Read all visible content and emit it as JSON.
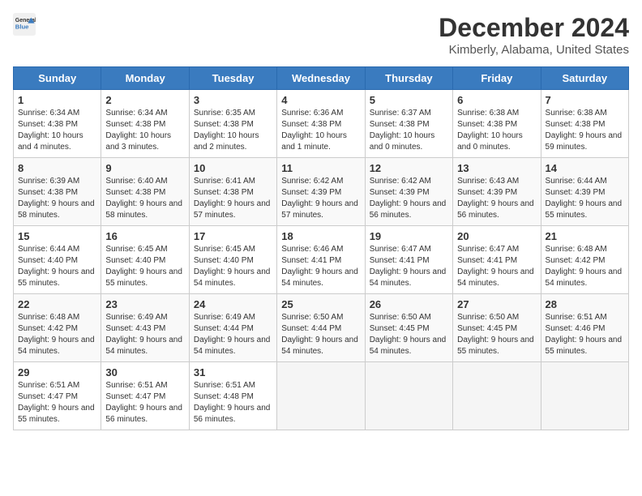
{
  "header": {
    "logo_line1": "General",
    "logo_line2": "Blue",
    "title": "December 2024",
    "subtitle": "Kimberly, Alabama, United States"
  },
  "days_of_week": [
    "Sunday",
    "Monday",
    "Tuesday",
    "Wednesday",
    "Thursday",
    "Friday",
    "Saturday"
  ],
  "weeks": [
    [
      {
        "day": "1",
        "sunrise": "6:34 AM",
        "sunset": "4:38 PM",
        "daylight": "Daylight: 10 hours and 4 minutes."
      },
      {
        "day": "2",
        "sunrise": "6:34 AM",
        "sunset": "4:38 PM",
        "daylight": "Daylight: 10 hours and 3 minutes."
      },
      {
        "day": "3",
        "sunrise": "6:35 AM",
        "sunset": "4:38 PM",
        "daylight": "Daylight: 10 hours and 2 minutes."
      },
      {
        "day": "4",
        "sunrise": "6:36 AM",
        "sunset": "4:38 PM",
        "daylight": "Daylight: 10 hours and 1 minute."
      },
      {
        "day": "5",
        "sunrise": "6:37 AM",
        "sunset": "4:38 PM",
        "daylight": "Daylight: 10 hours and 0 minutes."
      },
      {
        "day": "6",
        "sunrise": "6:38 AM",
        "sunset": "4:38 PM",
        "daylight": "Daylight: 10 hours and 0 minutes."
      },
      {
        "day": "7",
        "sunrise": "6:38 AM",
        "sunset": "4:38 PM",
        "daylight": "Daylight: 9 hours and 59 minutes."
      }
    ],
    [
      {
        "day": "8",
        "sunrise": "6:39 AM",
        "sunset": "4:38 PM",
        "daylight": "Daylight: 9 hours and 58 minutes."
      },
      {
        "day": "9",
        "sunrise": "6:40 AM",
        "sunset": "4:38 PM",
        "daylight": "Daylight: 9 hours and 58 minutes."
      },
      {
        "day": "10",
        "sunrise": "6:41 AM",
        "sunset": "4:38 PM",
        "daylight": "Daylight: 9 hours and 57 minutes."
      },
      {
        "day": "11",
        "sunrise": "6:42 AM",
        "sunset": "4:39 PM",
        "daylight": "Daylight: 9 hours and 57 minutes."
      },
      {
        "day": "12",
        "sunrise": "6:42 AM",
        "sunset": "4:39 PM",
        "daylight": "Daylight: 9 hours and 56 minutes."
      },
      {
        "day": "13",
        "sunrise": "6:43 AM",
        "sunset": "4:39 PM",
        "daylight": "Daylight: 9 hours and 56 minutes."
      },
      {
        "day": "14",
        "sunrise": "6:44 AM",
        "sunset": "4:39 PM",
        "daylight": "Daylight: 9 hours and 55 minutes."
      }
    ],
    [
      {
        "day": "15",
        "sunrise": "6:44 AM",
        "sunset": "4:40 PM",
        "daylight": "Daylight: 9 hours and 55 minutes."
      },
      {
        "day": "16",
        "sunrise": "6:45 AM",
        "sunset": "4:40 PM",
        "daylight": "Daylight: 9 hours and 55 minutes."
      },
      {
        "day": "17",
        "sunrise": "6:45 AM",
        "sunset": "4:40 PM",
        "daylight": "Daylight: 9 hours and 54 minutes."
      },
      {
        "day": "18",
        "sunrise": "6:46 AM",
        "sunset": "4:41 PM",
        "daylight": "Daylight: 9 hours and 54 minutes."
      },
      {
        "day": "19",
        "sunrise": "6:47 AM",
        "sunset": "4:41 PM",
        "daylight": "Daylight: 9 hours and 54 minutes."
      },
      {
        "day": "20",
        "sunrise": "6:47 AM",
        "sunset": "4:41 PM",
        "daylight": "Daylight: 9 hours and 54 minutes."
      },
      {
        "day": "21",
        "sunrise": "6:48 AM",
        "sunset": "4:42 PM",
        "daylight": "Daylight: 9 hours and 54 minutes."
      }
    ],
    [
      {
        "day": "22",
        "sunrise": "6:48 AM",
        "sunset": "4:42 PM",
        "daylight": "Daylight: 9 hours and 54 minutes."
      },
      {
        "day": "23",
        "sunrise": "6:49 AM",
        "sunset": "4:43 PM",
        "daylight": "Daylight: 9 hours and 54 minutes."
      },
      {
        "day": "24",
        "sunrise": "6:49 AM",
        "sunset": "4:44 PM",
        "daylight": "Daylight: 9 hours and 54 minutes."
      },
      {
        "day": "25",
        "sunrise": "6:50 AM",
        "sunset": "4:44 PM",
        "daylight": "Daylight: 9 hours and 54 minutes."
      },
      {
        "day": "26",
        "sunrise": "6:50 AM",
        "sunset": "4:45 PM",
        "daylight": "Daylight: 9 hours and 54 minutes."
      },
      {
        "day": "27",
        "sunrise": "6:50 AM",
        "sunset": "4:45 PM",
        "daylight": "Daylight: 9 hours and 55 minutes."
      },
      {
        "day": "28",
        "sunrise": "6:51 AM",
        "sunset": "4:46 PM",
        "daylight": "Daylight: 9 hours and 55 minutes."
      }
    ],
    [
      {
        "day": "29",
        "sunrise": "6:51 AM",
        "sunset": "4:47 PM",
        "daylight": "Daylight: 9 hours and 55 minutes."
      },
      {
        "day": "30",
        "sunrise": "6:51 AM",
        "sunset": "4:47 PM",
        "daylight": "Daylight: 9 hours and 56 minutes."
      },
      {
        "day": "31",
        "sunrise": "6:51 AM",
        "sunset": "4:48 PM",
        "daylight": "Daylight: 9 hours and 56 minutes."
      },
      null,
      null,
      null,
      null
    ]
  ]
}
